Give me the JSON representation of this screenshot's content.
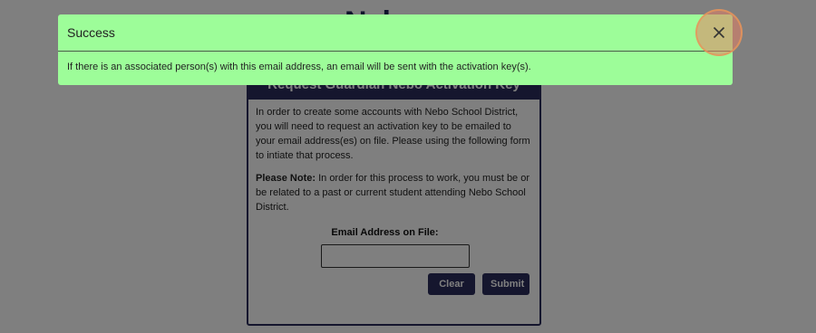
{
  "background": {
    "logo_text": "Nebo",
    "card": {
      "title": "Request Guardian Nebo Activation Key",
      "intro": "In order to create some accounts with Nebo School District, you will need to request an activation key to be emailed to your email address(es) on file. Please using the following form to intiate that process.",
      "note_label": "Please Note:",
      "note_text": " In order for this process to work, you must be or be related to a past or current student attending Nebo School District.",
      "email_label": "Email Address on File:",
      "email_value": "",
      "clear_label": "Clear",
      "submit_label": "Submit"
    }
  },
  "modal": {
    "title": "Success",
    "message": "If there is an associated person(s) with this email address, an email will be sent with the activation key(s).",
    "close_icon": "close-icon",
    "background_color": "#9dfd99"
  },
  "colors": {
    "brand": "#2a2d5c",
    "overlay": "rgba(0,0,0,0.5)",
    "close_highlight": "#e48064"
  }
}
